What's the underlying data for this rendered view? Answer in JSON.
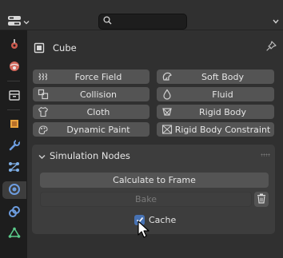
{
  "header": {
    "editor_type_icon": "properties-editor-icon",
    "search": {
      "value": "",
      "placeholder": ""
    }
  },
  "tabs": [
    "tool-icon",
    "render-icon",
    "output-icon",
    "object-icon",
    "modifier-icon",
    "particles-icon",
    "physics-icon",
    "constraints-icon",
    "data-icon"
  ],
  "active_tab": "physics",
  "object": {
    "name": "Cube"
  },
  "physics_buttons": [
    {
      "label": "Force Field",
      "icon": "force-field-icon"
    },
    {
      "label": "Soft Body",
      "icon": "soft-body-icon"
    },
    {
      "label": "Collision",
      "icon": "collision-icon"
    },
    {
      "label": "Fluid",
      "icon": "fluid-icon"
    },
    {
      "label": "Cloth",
      "icon": "cloth-icon"
    },
    {
      "label": "Rigid Body",
      "icon": "rigid-body-icon"
    },
    {
      "label": "Dynamic Paint",
      "icon": "dynamic-paint-icon"
    },
    {
      "label": "Rigid Body Constraint",
      "icon": "rigid-body-constraint-icon"
    }
  ],
  "panel": {
    "title": "Simulation Nodes",
    "calculate_label": "Calculate to Frame",
    "bake_label": "Bake",
    "cache_label": "Cache",
    "cache_checked": true
  },
  "colors": {
    "accent": "#4772b3",
    "button": "#545454",
    "panel": "#3d3d3d",
    "background": "#303030"
  }
}
